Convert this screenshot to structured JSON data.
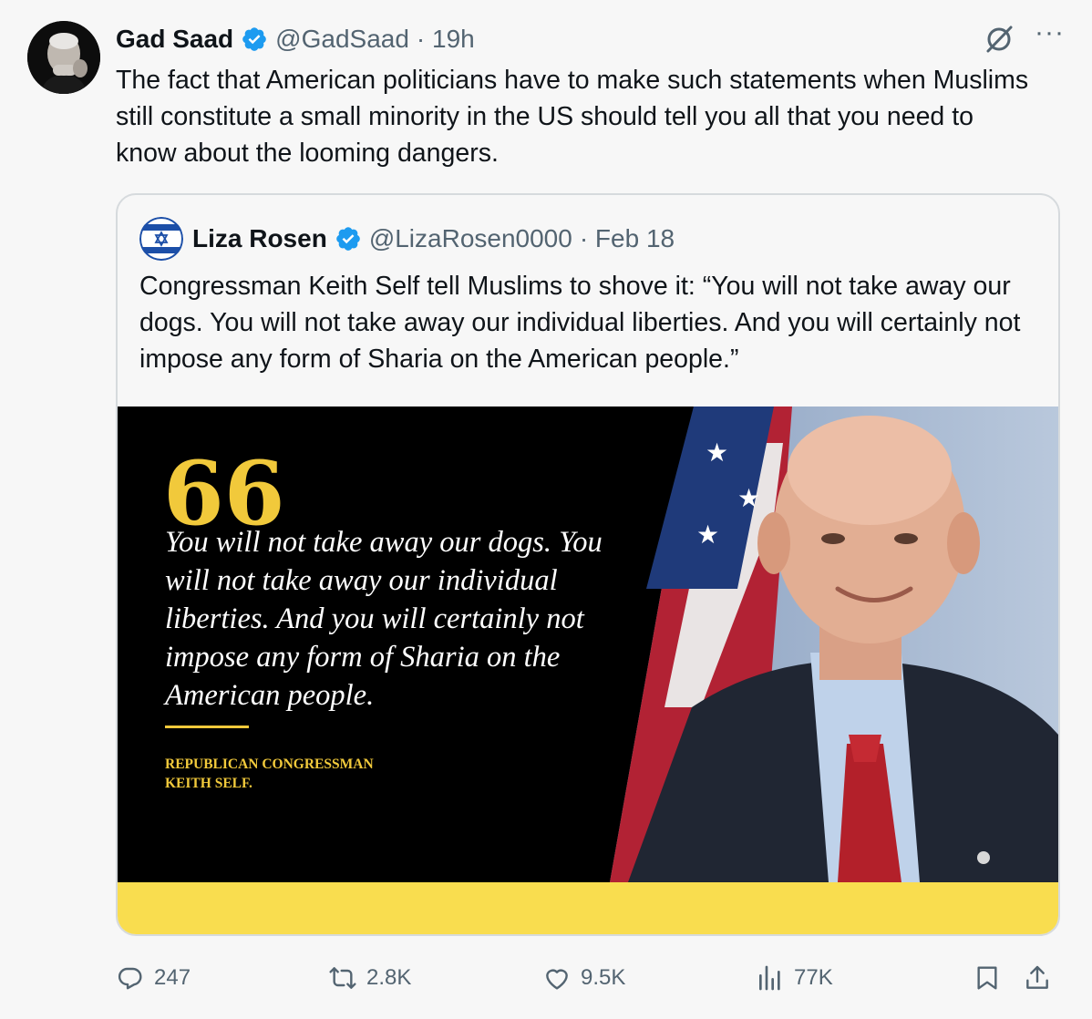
{
  "author": {
    "name": "Gad Saad",
    "handle": "@GadSaad",
    "time": "· 19h"
  },
  "tweet_text": "The fact that American politicians have to make such statements when Muslims still constitute a small minority in the US should tell you all that you need to know about the looming dangers.",
  "quoted": {
    "name": "Liza Rosen",
    "handle": "@LizaRosen0000",
    "time": "· Feb 18",
    "text": "Congressman Keith Self tell Muslims to shove it: “You will not take away our dogs. You will not take away our individual liberties. And you will certainly not impose any form of Sharia on the American people.”",
    "media": {
      "quote_mark": "66",
      "quote": "You will not take away our dogs. You will not take away our individual liberties. And you will certainly not impose any form of Sharia on the American people.",
      "attribution": "REPUBLICAN CONGRESSMAN KEITH SELF."
    }
  },
  "actions": {
    "replies": "247",
    "reposts": "2.8K",
    "likes": "9.5K",
    "views": "77K"
  },
  "colors": {
    "verified": "#1d9bf0",
    "muted": "#536471",
    "media_accent": "#f1c93b",
    "media_bar": "#f9dd4f"
  },
  "icons": {
    "grok": "grok-icon",
    "more": "more-icon",
    "reply": "reply-icon",
    "repost": "repost-icon",
    "like": "like-icon",
    "views": "views-icon",
    "bookmark": "bookmark-icon",
    "share": "share-icon"
  }
}
